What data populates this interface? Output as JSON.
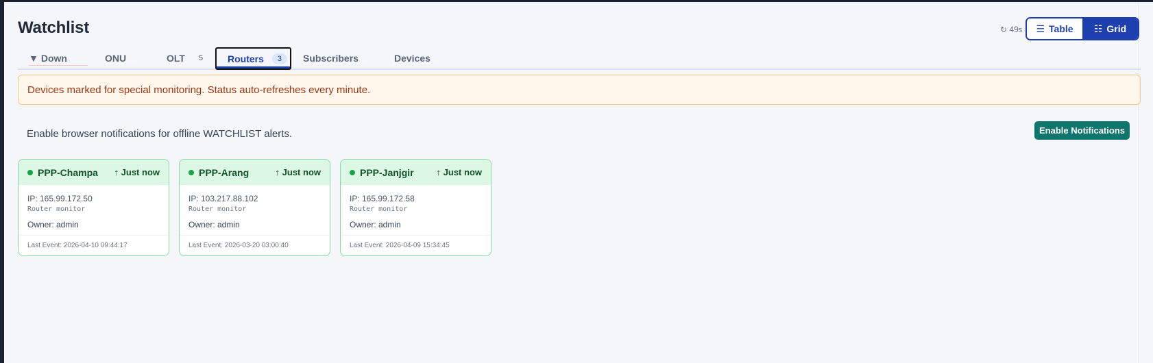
{
  "page": {
    "title": "Watchlist"
  },
  "refresh": {
    "icon": "refresh-icon",
    "seconds": "49",
    "unit": "s"
  },
  "view_toggle": {
    "table": {
      "icon": "list-icon",
      "label": "Table"
    },
    "grid": {
      "icon": "grid-icon",
      "label": "Grid"
    },
    "active": "Grid"
  },
  "tabs": [
    {
      "label": "Down",
      "icon": "triangle-down-icon",
      "count": ""
    },
    {
      "label": "ONU",
      "count": ""
    },
    {
      "label": "OLT",
      "count": "5"
    },
    {
      "label": "Routers",
      "count": "3",
      "active": true
    },
    {
      "label": "Subscribers",
      "count": ""
    },
    {
      "label": "Devices",
      "count": ""
    }
  ],
  "alert": {
    "text": "Devices marked for special monitoring. Status auto-refreshes every minute."
  },
  "notifications": {
    "text": "Enable browser notifications for offline WATCHLIST alerts.",
    "button_label": "Enable Notifications"
  },
  "cards": [
    {
      "name": "PPP-Champa",
      "status": "online",
      "seen": "↑ Just now",
      "ip": "IP: 165.99.172.50",
      "kind": "Router monitor",
      "owner": "Owner: admin",
      "last_event": "Last Event: 2026-04-10 09:44:17"
    },
    {
      "name": "PPP-Arang",
      "status": "online",
      "seen": "↑ Just now",
      "ip": "IP: 103.217.88.102",
      "kind": "Router monitor",
      "owner": "Owner: admin",
      "last_event": "Last Event: 2026-03-20 03:00:40"
    },
    {
      "name": "PPP-Janjgir",
      "status": "online",
      "seen": "↑ Just now",
      "ip": "IP: 165.99.172.58",
      "kind": "Router monitor",
      "owner": "Owner: admin",
      "last_event": "Last Event: 2026-04-09 15:34:45"
    }
  ],
  "colors": {
    "accent": "#1e40af",
    "online": "#16a34a",
    "alert_text": "#9a3412",
    "notify_button": "#0f766e"
  }
}
